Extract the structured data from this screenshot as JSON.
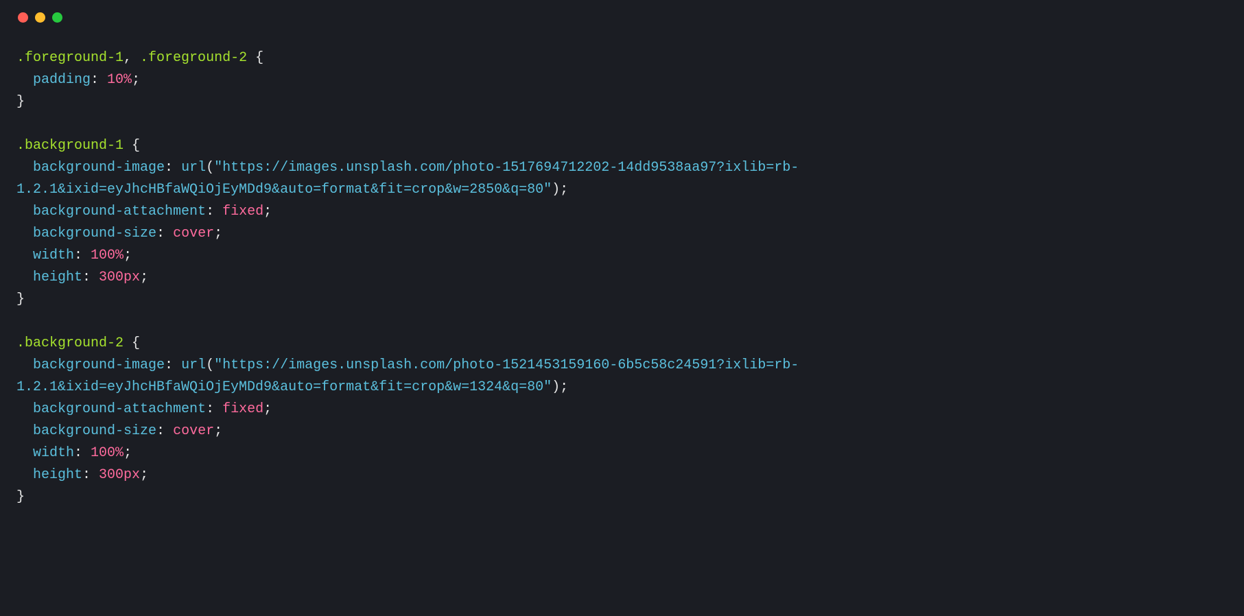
{
  "traffic_lights": {
    "red": "#ff5f56",
    "yellow": "#ffbd2e",
    "green": "#27c93f"
  },
  "code": {
    "rule1": {
      "sel1": ".foreground-1",
      "sep": ", ",
      "sel2": ".foreground-2",
      "open": " {",
      "prop1_name": "padding",
      "prop1_colon": ": ",
      "prop1_val": "10%",
      "prop1_semi": ";",
      "close": "}"
    },
    "rule2": {
      "sel": ".background-1",
      "open": " {",
      "p1_name": "background-image",
      "p1_colon": ": ",
      "p1_func": "url",
      "p1_open": "(",
      "p1_q1": "\"",
      "p1_url_line1": "https://images.unsplash.com/photo-1517694712202-14dd9538aa97?ixlib=rb-",
      "p1_url_line2": "1.2.1&ixid=eyJhcHBfaWQiOjEyMDd9&auto=format&fit=crop&w=2850&q=80",
      "p1_q2": "\"",
      "p1_close": ")",
      "p1_semi": ";",
      "p2_name": "background-attachment",
      "p2_colon": ": ",
      "p2_val": "fixed",
      "p2_semi": ";",
      "p3_name": "background-size",
      "p3_colon": ": ",
      "p3_val": "cover",
      "p3_semi": ";",
      "p4_name": "width",
      "p4_colon": ": ",
      "p4_val": "100%",
      "p4_semi": ";",
      "p5_name": "height",
      "p5_colon": ": ",
      "p5_val": "300px",
      "p5_semi": ";",
      "close": "}"
    },
    "rule3": {
      "sel": ".background-2",
      "open": " {",
      "p1_name": "background-image",
      "p1_colon": ": ",
      "p1_func": "url",
      "p1_open": "(",
      "p1_q1": "\"",
      "p1_url_line1": "https://images.unsplash.com/photo-1521453159160-6b5c58c24591?ixlib=rb-",
      "p1_url_line2": "1.2.1&ixid=eyJhcHBfaWQiOjEyMDd9&auto=format&fit=crop&w=1324&q=80",
      "p1_q2": "\"",
      "p1_close": ")",
      "p1_semi": ";",
      "p2_name": "background-attachment",
      "p2_colon": ": ",
      "p2_val": "fixed",
      "p2_semi": ";",
      "p3_name": "background-size",
      "p3_colon": ": ",
      "p3_val": "cover",
      "p3_semi": ";",
      "p4_name": "width",
      "p4_colon": ": ",
      "p4_val": "100%",
      "p4_semi": ";",
      "p5_name": "height",
      "p5_colon": ": ",
      "p5_val": "300px",
      "p5_semi": ";",
      "close": "}"
    }
  }
}
